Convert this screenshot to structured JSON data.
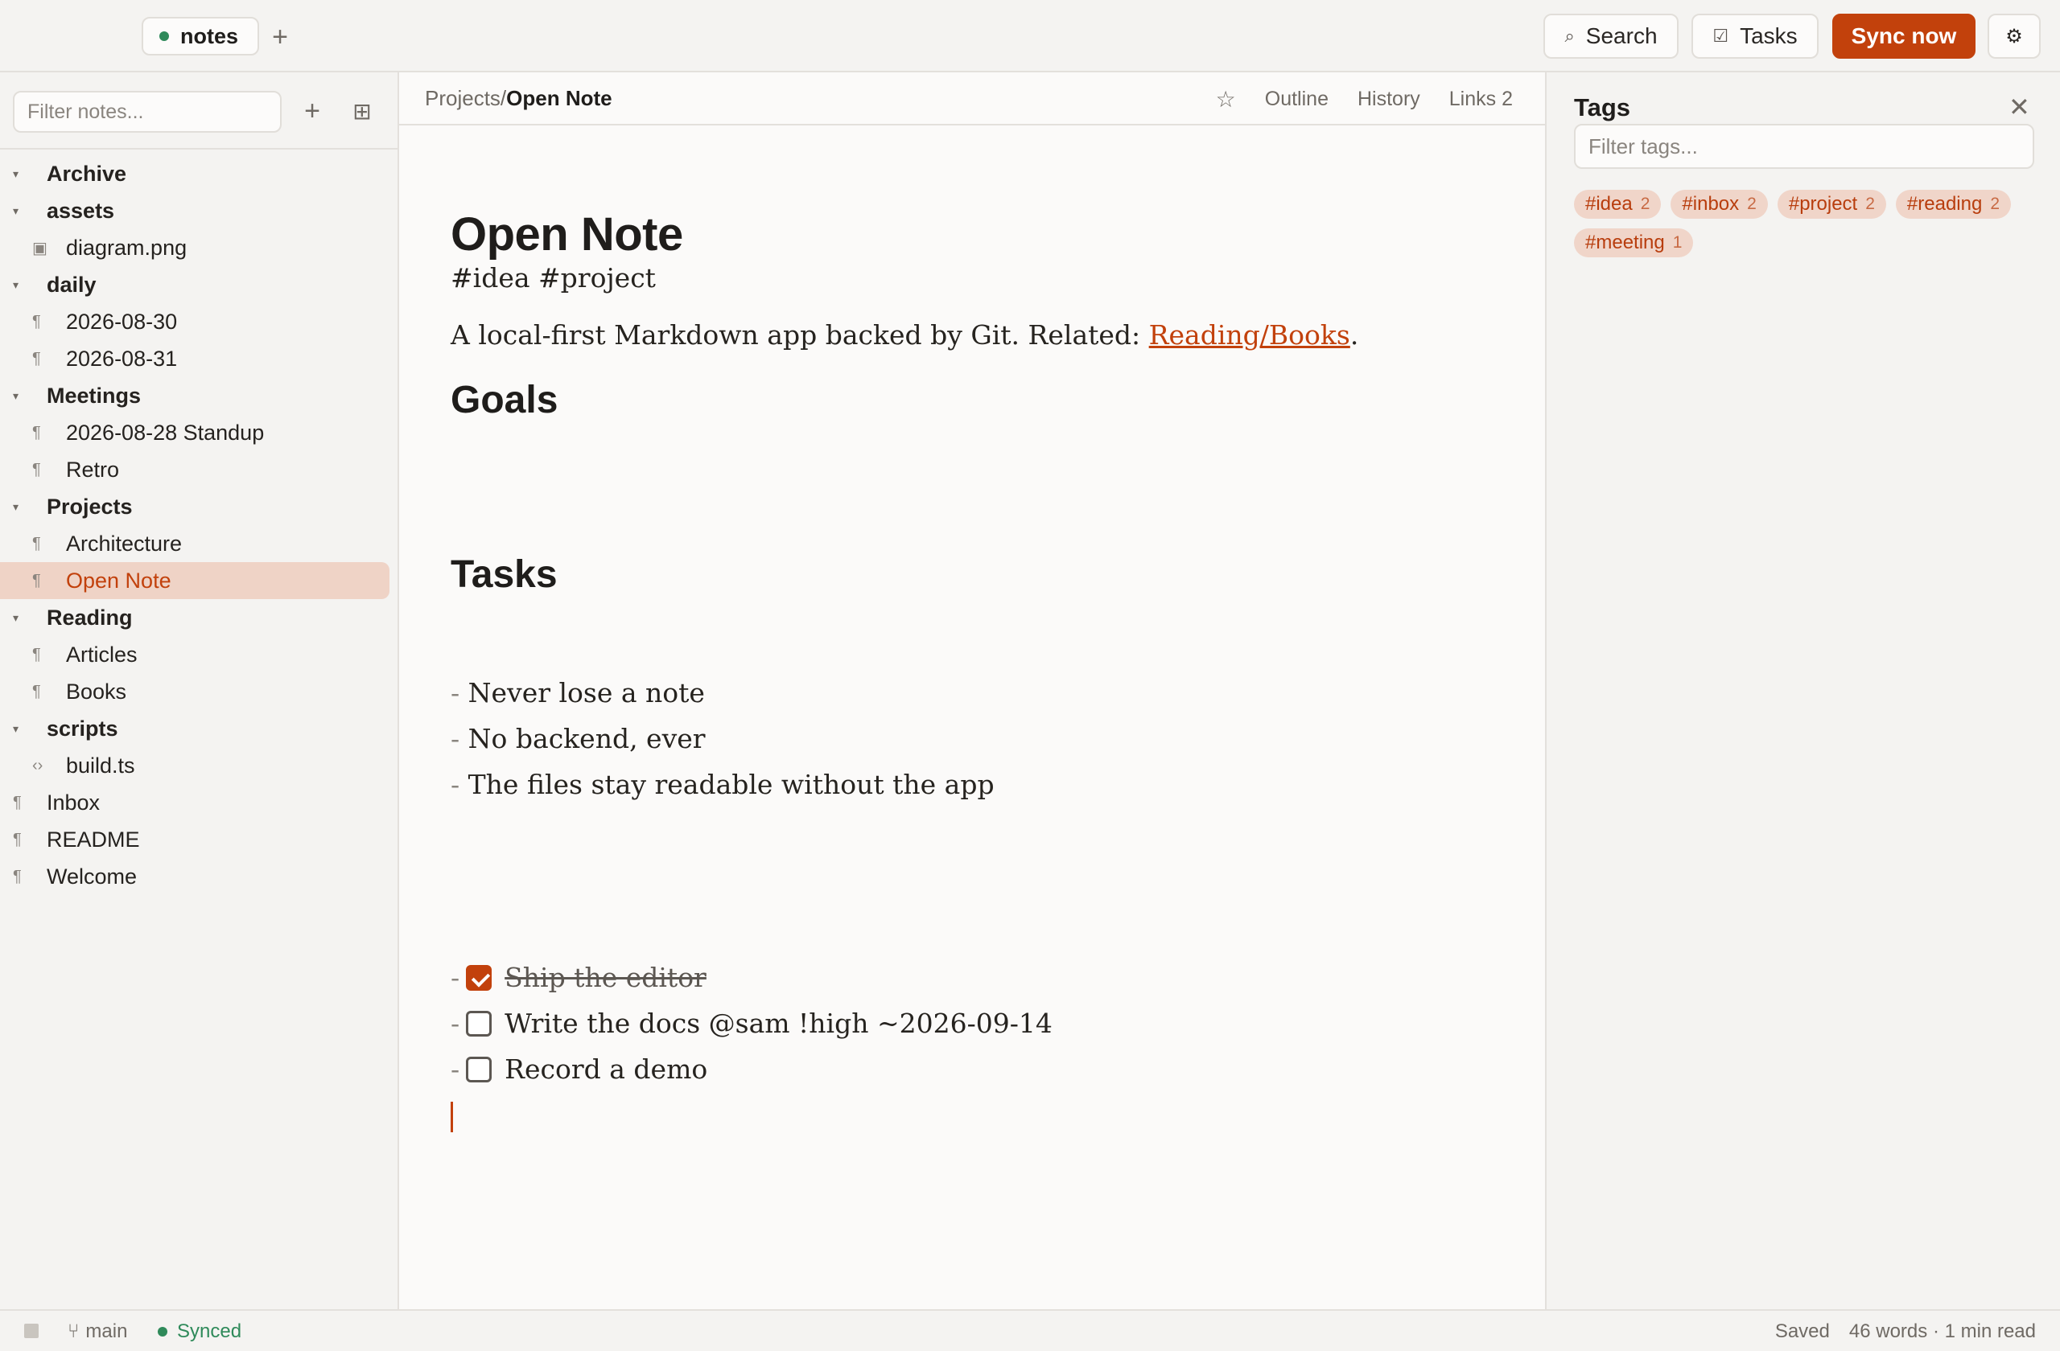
{
  "topbar": {
    "vault_name": "notes",
    "add_vault": "+",
    "search_icon": "⌕",
    "search_label": "Search",
    "tasks_icon": "☑",
    "tasks_label": "Tasks",
    "sync_label": "Sync now",
    "settings_icon": "⚙"
  },
  "sidebar": {
    "filter_placeholder": "Filter notes...",
    "add_icon": "+",
    "grid_icon": "⊞",
    "tree": [
      {
        "label": "Archive",
        "type": "folder"
      },
      {
        "label": "assets",
        "type": "folder"
      },
      {
        "label": "diagram.png",
        "type": "image",
        "child": true
      },
      {
        "label": "daily",
        "type": "folder"
      },
      {
        "label": "2026-08-30",
        "type": "note",
        "child": true
      },
      {
        "label": "2026-08-31",
        "type": "note",
        "child": true
      },
      {
        "label": "Meetings",
        "type": "folder"
      },
      {
        "label": "2026-08-28 Standup",
        "type": "note",
        "child": true
      },
      {
        "label": "Retro",
        "type": "note",
        "child": true
      },
      {
        "label": "Projects",
        "type": "folder"
      },
      {
        "label": "Architecture",
        "type": "note",
        "child": true
      },
      {
        "label": "Open Note",
        "type": "note",
        "child": true,
        "selected": true
      },
      {
        "label": "Reading",
        "type": "folder"
      },
      {
        "label": "Articles",
        "type": "note",
        "child": true
      },
      {
        "label": "Books",
        "type": "note",
        "child": true
      },
      {
        "label": "scripts",
        "type": "folder"
      },
      {
        "label": "build.ts",
        "type": "code",
        "child": true
      },
      {
        "label": "Inbox",
        "type": "note"
      },
      {
        "label": "README",
        "type": "note"
      },
      {
        "label": "Welcome",
        "type": "note"
      }
    ]
  },
  "editor": {
    "breadcrumb_parent": "Projects/",
    "breadcrumb_current": "Open Note",
    "star_icon": "☆",
    "outline_label": "Outline",
    "history_label": "History",
    "links_label": "Links 2",
    "title": "Open Note",
    "tags_line": "#idea #project",
    "intro_text": "A local-first Markdown app backed by Git. Related: ",
    "intro_link": "Reading/Books",
    "intro_end": ".",
    "goals_heading": "Goals",
    "goals": [
      "Never lose a note",
      "No backend, ever",
      "The files stay readable without the app"
    ],
    "tasks_heading": "Tasks",
    "tasks": [
      {
        "text": "Ship the editor",
        "done": true
      },
      {
        "text": "Write the docs @sam !high ~2026-09-14",
        "done": false
      },
      {
        "text": "Record a demo",
        "done": false
      }
    ],
    "bullet": "-"
  },
  "tags_panel": {
    "title": "Tags",
    "close_icon": "✕",
    "filter_placeholder": "Filter tags...",
    "tags": [
      {
        "name": "#idea",
        "count": "2"
      },
      {
        "name": "#inbox",
        "count": "2"
      },
      {
        "name": "#project",
        "count": "2"
      },
      {
        "name": "#reading",
        "count": "2"
      },
      {
        "name": "#meeting",
        "count": "1"
      }
    ]
  },
  "statusbar": {
    "branch_icon": "⑂",
    "branch": "main",
    "sync_status": "Synced",
    "save_status": "Saved",
    "stats": "46 words · 1 min read"
  },
  "colors": {
    "accent": "#c2410c",
    "synced": "#2f8a5a",
    "selected_bg": "#efd3c6",
    "tag_bg": "#f0d5c9"
  }
}
